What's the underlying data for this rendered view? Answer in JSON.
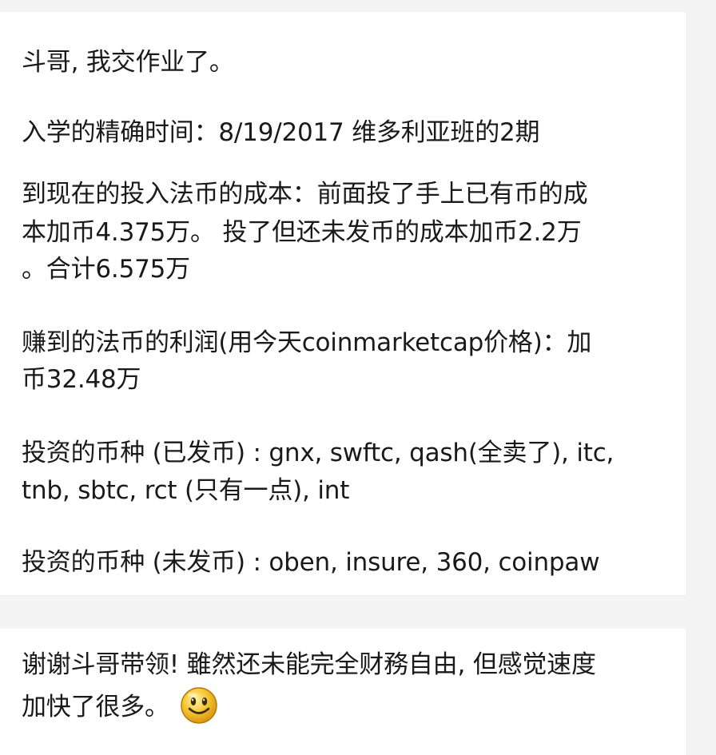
{
  "post": {
    "greeting": "斗哥, 我交作业了。",
    "enroll": "入学的精确时间：8/19/2017 维多利亚班的2期",
    "cost_line1": "到现在的投入法币的成本：前面投了手上已有币的成",
    "cost_line2": "本加币4.375万。 投了但还未发币的成本加币2.2万",
    "cost_line3": "。合计6.575万",
    "profit_line1": "赚到的法币的利润(用今天coinmarketcap价格)：加",
    "profit_line2": "币32.48万",
    "issued_line1": "投资的币种 (已发币) : gnx, swftc, qash(全卖了), itc,",
    "issued_line2": "tnb, sbtc, rct (只有一点), int",
    "unissued_line": "投资的币种 (未发币) : oben, insure, 360, coinpaw"
  },
  "reply": {
    "line1": "谢谢斗哥带领! 雖然还未能完全财務自由, 但感觉速度",
    "line2": "加快了很多。",
    "emoji_icon": "smiley-emoji-icon"
  },
  "colors": {
    "background": "#f4f4f4",
    "card": "#ffffff",
    "text": "#1a1a1a",
    "emoji_face": "#f6c531"
  }
}
